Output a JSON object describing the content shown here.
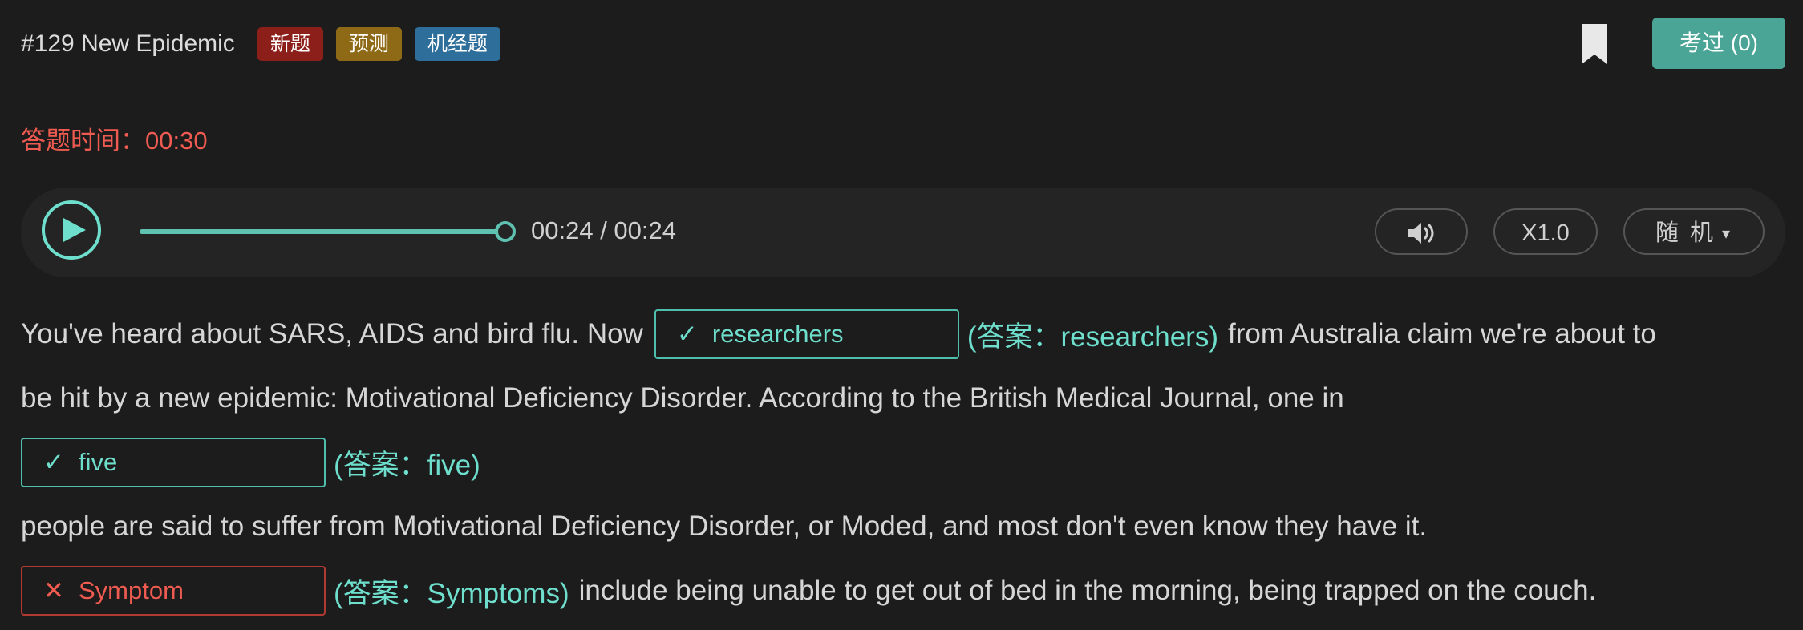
{
  "header": {
    "question_title": "#129 New Epidemic",
    "tags": [
      {
        "label": "新题",
        "color": "#8d1f1b"
      },
      {
        "label": "预测",
        "color": "#8f6a16"
      },
      {
        "label": "机经题",
        "color": "#2e6e9a"
      }
    ],
    "bookmark_icon": "bookmark-icon",
    "passed_button": "考过 (0)",
    "passed_button_color": "#4aa596"
  },
  "timer": {
    "text": "答题时间：00:30"
  },
  "audio": {
    "play_icon": "play-icon",
    "progress": 1.0,
    "time_text": "00:24 / 00:24",
    "volume_icon": "volume-icon",
    "speed_label": "X1.0",
    "mode_label": "随 机",
    "mode_caret": "▾"
  },
  "passage": {
    "line1_pre": "You've heard about SARS, AIDS and bird flu. Now",
    "blank1": {
      "mark": "✓",
      "value": "researchers",
      "status": "correct"
    },
    "answer1": "(答案：researchers)",
    "line1_post": "from Australia claim we're about to",
    "line2": "be hit by a new epidemic: Motivational Deficiency Disorder. According to the British Medical Journal, one in",
    "blank2": {
      "mark": "✓",
      "value": "five",
      "status": "correct"
    },
    "answer2": "(答案：five)",
    "line4": "people are said to suffer from Motivational Deficiency Disorder, or Moded, and most don't even know they have it.",
    "blank3": {
      "mark": "✕",
      "value": "Symptom",
      "status": "wrong"
    },
    "answer3": "(答案：Symptoms)",
    "line5_post": "include being unable to get out of bed in the morning, being trapped on the couch."
  },
  "colors": {
    "accent": "#6fdfcd",
    "error": "#ef5b51",
    "background": "#1c1c1c"
  }
}
